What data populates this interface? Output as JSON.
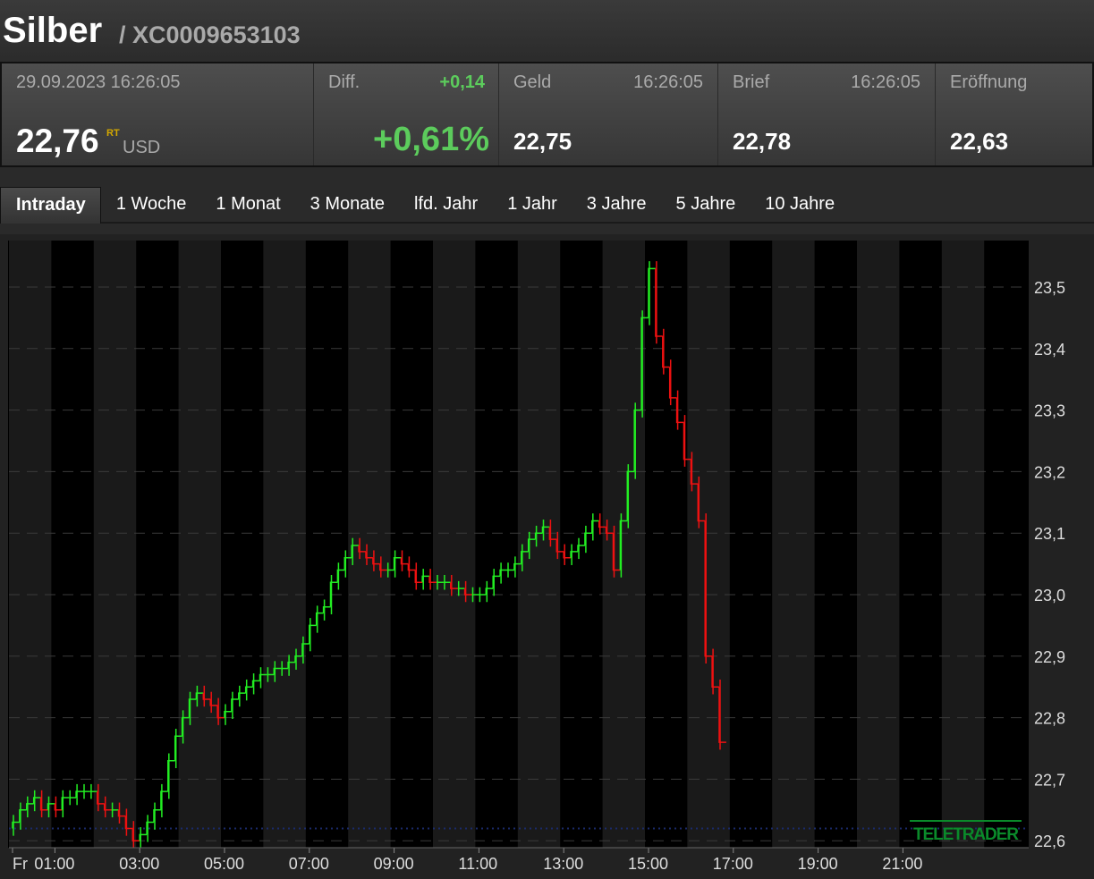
{
  "header": {
    "title": "Silber",
    "separator": "/",
    "isin": "XC0009653103"
  },
  "quote": {
    "datetime": "29.09.2023 16:26:05",
    "price": "22,76",
    "rt_badge": "RT",
    "currency": "USD",
    "diff_label": "Diff.",
    "diff_abs": "+0,14",
    "diff_pct": "+0,61%",
    "geld_label": "Geld",
    "geld_time": "16:26:05",
    "geld": "22,75",
    "brief_label": "Brief",
    "brief_time": "16:26:05",
    "brief": "22,78",
    "open_label": "Eröffnung",
    "open": "22,63"
  },
  "colors": {
    "up": "#22ee22",
    "down": "#ee1111",
    "positive_text": "#5ccc5c",
    "badge": "#d4a800",
    "prev_close_line": "#1a2a6a"
  },
  "tabs": [
    {
      "label": "Intraday",
      "active": true
    },
    {
      "label": "1 Woche"
    },
    {
      "label": "1 Monat"
    },
    {
      "label": "3 Monate"
    },
    {
      "label": "lfd. Jahr"
    },
    {
      "label": "1 Jahr"
    },
    {
      "label": "3 Jahre"
    },
    {
      "label": "5 Jahre"
    },
    {
      "label": "10 Jahre"
    }
  ],
  "chart_data": {
    "type": "line",
    "style": "step-bars up/down colored",
    "x_ticks": [
      "Fr",
      "01:00",
      "03:00",
      "05:00",
      "07:00",
      "09:00",
      "11:00",
      "13:00",
      "15:00",
      "17:00",
      "19:00",
      "21:00"
    ],
    "x_tick_hours": [
      0,
      1,
      3,
      5,
      7,
      9,
      11,
      13,
      15,
      17,
      19,
      21
    ],
    "xlim_hours": [
      0,
      24
    ],
    "y_ticks": [
      "23,5",
      "23,4",
      "23,3",
      "23,2",
      "23,1",
      "23,0",
      "22,9",
      "22,8",
      "22,7",
      "22,6"
    ],
    "y_tick_values": [
      23.5,
      23.4,
      23.3,
      23.2,
      23.1,
      23.0,
      22.9,
      22.8,
      22.7,
      22.6
    ],
    "ylim": [
      22.58,
      23.57
    ],
    "grid": "horizontal dashed",
    "prev_close": 22.62,
    "watermark": "TELETRADER",
    "interval_minutes": 10,
    "start_hour": 0,
    "values": [
      22.63,
      22.65,
      22.66,
      22.67,
      22.65,
      22.66,
      22.65,
      22.67,
      22.67,
      22.68,
      22.68,
      22.68,
      22.66,
      22.65,
      22.65,
      22.64,
      22.62,
      22.6,
      22.61,
      22.63,
      22.65,
      22.68,
      22.73,
      22.77,
      22.8,
      22.83,
      22.84,
      22.83,
      22.82,
      22.8,
      22.81,
      22.83,
      22.84,
      22.85,
      22.86,
      22.87,
      22.87,
      22.88,
      22.88,
      22.89,
      22.9,
      22.92,
      22.95,
      22.97,
      22.98,
      23.02,
      23.04,
      23.06,
      23.08,
      23.07,
      23.06,
      23.05,
      23.04,
      23.04,
      23.06,
      23.05,
      23.04,
      23.02,
      23.03,
      23.02,
      23.02,
      23.02,
      23.01,
      23.01,
      23.0,
      23.0,
      23.0,
      23.01,
      23.03,
      23.04,
      23.04,
      23.05,
      23.07,
      23.09,
      23.1,
      23.11,
      23.09,
      23.07,
      23.06,
      23.07,
      23.08,
      23.1,
      23.12,
      23.11,
      23.1,
      23.04,
      23.12,
      23.2,
      23.3,
      23.45,
      23.53,
      23.42,
      23.37,
      23.32,
      23.28,
      23.22,
      23.18,
      23.12,
      22.9,
      22.85,
      22.76
    ]
  }
}
